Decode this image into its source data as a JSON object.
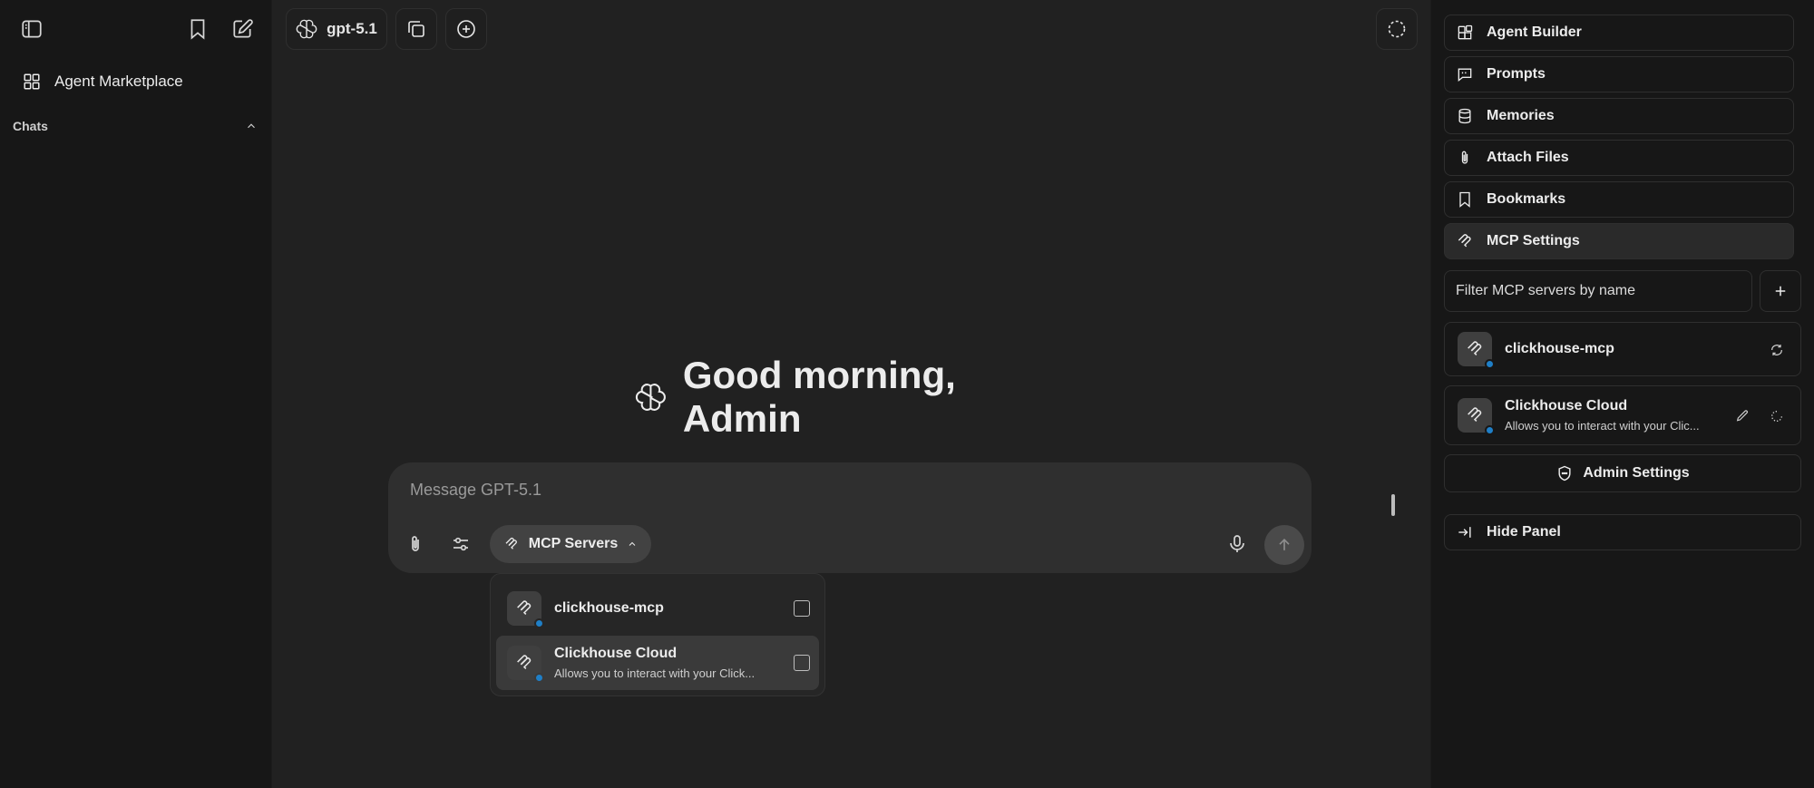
{
  "sidebar": {
    "items": [
      {
        "label": "Agent Marketplace",
        "icon": "grid-icon"
      }
    ],
    "section_title": "Chats"
  },
  "topbar": {
    "model_label": "gpt-5.1"
  },
  "main": {
    "greeting": "Good morning, Admin",
    "composer": {
      "placeholder": "Message GPT-5.1",
      "mcp_button_label": "MCP Servers"
    },
    "mcp_dropdown": {
      "items": [
        {
          "name": "clickhouse-mcp",
          "description": "",
          "checked": false
        },
        {
          "name": "Clickhouse Cloud",
          "description": "Allows you to interact with your Click...",
          "checked": false
        }
      ]
    }
  },
  "right_panel": {
    "nav": [
      {
        "label": "Agent Builder",
        "icon": "blocks-icon"
      },
      {
        "label": "Prompts",
        "icon": "message-square-quote-icon"
      },
      {
        "label": "Memories",
        "icon": "database-icon"
      },
      {
        "label": "Attach Files",
        "icon": "paperclip-icon"
      },
      {
        "label": "Bookmarks",
        "icon": "bookmark-icon"
      },
      {
        "label": "MCP Settings",
        "icon": "mcp-icon"
      }
    ],
    "filter_placeholder": "Filter MCP servers by name",
    "servers": [
      {
        "name": "clickhouse-mcp",
        "description": ""
      },
      {
        "name": "Clickhouse Cloud",
        "description": "Allows you to interact with your Clic..."
      }
    ],
    "admin_settings_label": "Admin Settings",
    "hide_panel_label": "Hide Panel"
  },
  "colors": {
    "background": "#212121",
    "sidebar": "#171717",
    "composer": "#2f2f2f",
    "status_dot": "#1f7fc7"
  }
}
